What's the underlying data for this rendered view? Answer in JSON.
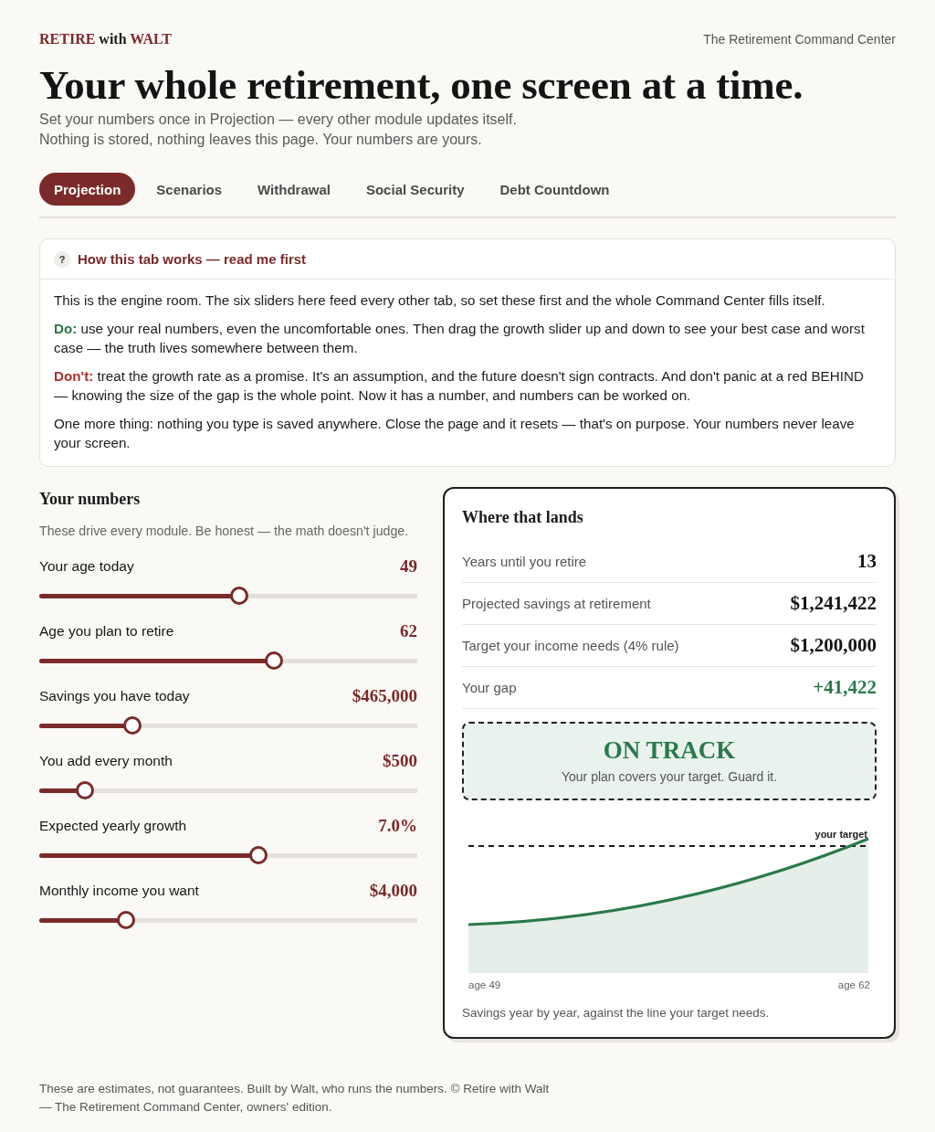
{
  "brand": {
    "logo": [
      {
        "text": "RETIRE",
        "accent": true
      },
      {
        "text": "with",
        "accent": false
      },
      {
        "text": "WALT",
        "accent": true
      }
    ],
    "tagline": "The Retirement Command Center"
  },
  "hero": {
    "title": "Your whole retirement, one screen at a time.",
    "subtitle_lines": [
      "Set your numbers once in Projection — every other module updates itself.",
      "Nothing is stored, nothing leaves this page. Your numbers are yours."
    ]
  },
  "tabs": [
    {
      "label": "Projection",
      "selected": true
    },
    {
      "label": "Scenarios",
      "selected": false
    },
    {
      "label": "Withdrawal",
      "selected": false
    },
    {
      "label": "Social Security",
      "selected": false
    },
    {
      "label": "Debt Countdown",
      "selected": false
    }
  ],
  "help": {
    "icon": "?",
    "title": "How this tab works — read me first",
    "paragraphs": [
      {
        "text": "This is the engine room. The six sliders here feed every other tab, so set these first and the whole Command Center fills itself."
      },
      {
        "color": "#2a7a4b",
        "text": "**Do:** use your real numbers, even the uncomfortable ones. Then drag the growth slider up and down to see your best case and worst case — the truth lives somewhere between them."
      },
      {
        "color": "#a83232",
        "text": "**Don't:** treat the growth rate as a promise. It's an assumption, and the future doesn't sign contracts. And don't panic at a red BEHIND — knowing the size of the gap is the whole point. Now it has a number, and numbers can be worked on."
      },
      {
        "text": "One more thing: nothing you type is saved anywhere. Close the page and it resets — that's on purpose. Your numbers never leave your screen."
      }
    ]
  },
  "numbers": {
    "title": "Your numbers",
    "description": "These drive every module. Be honest — the math doesn't judge.",
    "sliders": [
      {
        "label": "Your age today",
        "value": "49",
        "level": 0.53
      },
      {
        "label": "Age you plan to retire",
        "value": "62",
        "level": 0.62
      },
      {
        "label": "Savings you have today",
        "value": "$465,000",
        "level": 0.246
      },
      {
        "label": "You add every month",
        "value": "$500",
        "level": 0.121
      },
      {
        "label": "Expected yearly growth",
        "value": "7.0%",
        "level": 0.58
      },
      {
        "label": "Monthly income you want",
        "value": "$4,000",
        "level": 0.229
      }
    ]
  },
  "results": {
    "title": "Where that lands",
    "rows": [
      {
        "label": "Years until you retire",
        "value": "13",
        "positive": false
      },
      {
        "label": "Projected savings at retirement",
        "value": "$1,241,422",
        "positive": false
      },
      {
        "label": "Target your income needs (4% rule)",
        "value": "$1,200,000",
        "positive": false
      },
      {
        "label": "Your gap",
        "value": "+41,422",
        "positive": true
      }
    ],
    "status": {
      "on_track": true,
      "title": "ON TRACK",
      "message": "Your plan covers your target. Guard it."
    },
    "chart": {
      "target_label": "your target",
      "start_label": "age 49",
      "end_label": "age 62",
      "caption": "Savings year by year, against the line your target needs."
    }
  },
  "footer": {
    "text": "These are estimates, not guarantees. Built by Walt, who runs the numbers. © Retire with Walt — The Retirement Command Center, owners' edition."
  }
}
